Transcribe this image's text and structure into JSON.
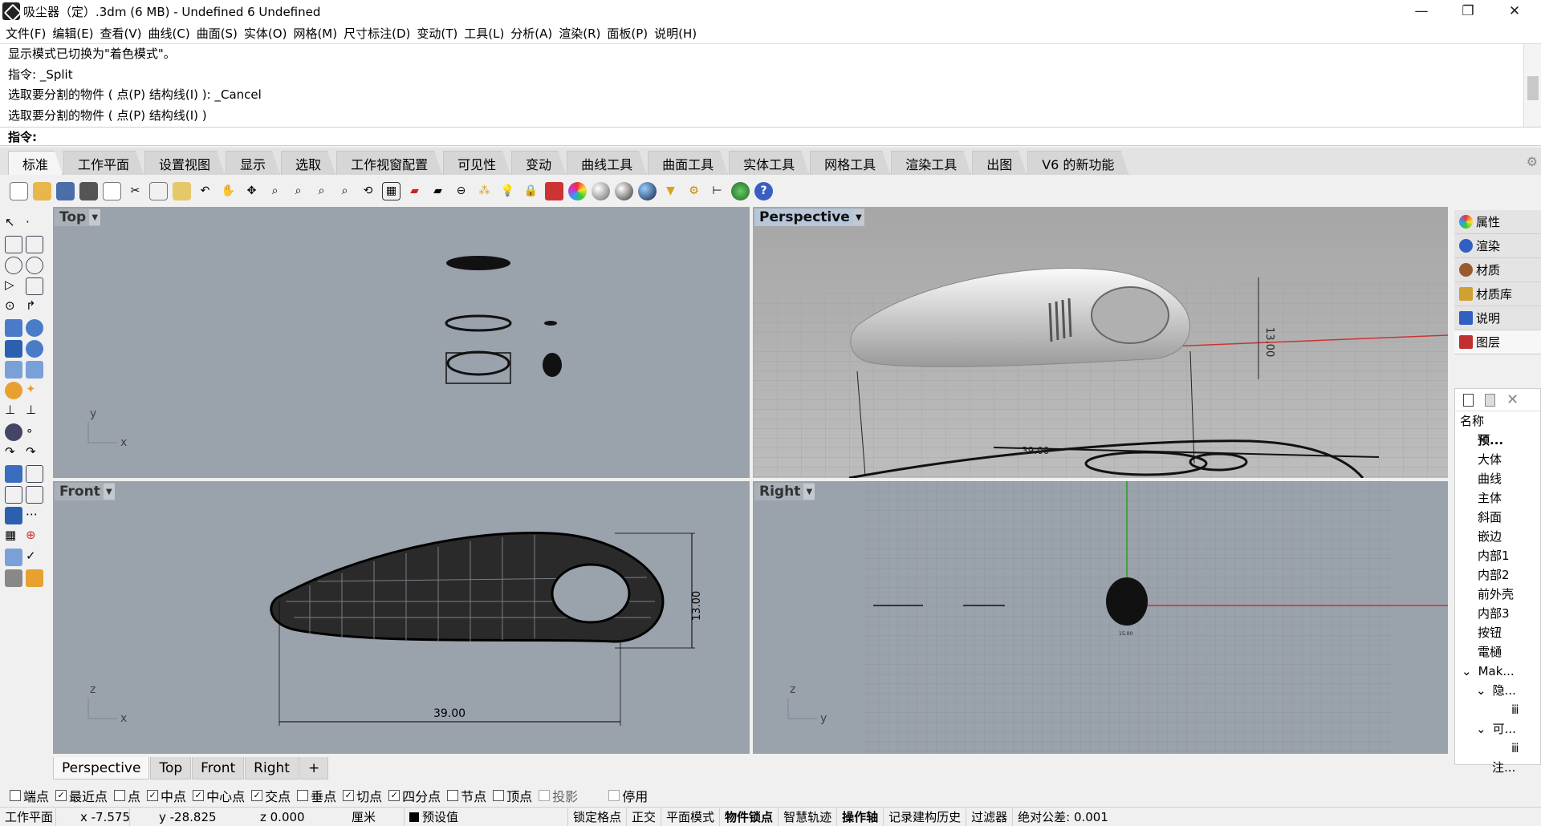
{
  "window": {
    "title": "吸尘器（定）.3dm (6 MB) - Undefined 6 Undefined",
    "minimize": "—",
    "maximize": "❐",
    "close": "✕"
  },
  "menu": [
    "文件(F)",
    "编辑(E)",
    "查看(V)",
    "曲线(C)",
    "曲面(S)",
    "实体(O)",
    "网格(M)",
    "尺寸标注(D)",
    "变动(T)",
    "工具(L)",
    "分析(A)",
    "渲染(R)",
    "面板(P)",
    "说明(H)"
  ],
  "command_history": [
    "显示模式已切换为\"着色模式\"。",
    "指令: _Split",
    "选取要分割的物件 ( 点(P)  结构线(I) ): _Cancel",
    "选取要分割的物件 ( 点(P)  结构线(I) )"
  ],
  "command_prompt": {
    "label": "指令:",
    "value": ""
  },
  "toolbar_tabs": [
    "标准",
    "工作平面",
    "设置视图",
    "显示",
    "选取",
    "工作视窗配置",
    "可见性",
    "变动",
    "曲线工具",
    "曲面工具",
    "实体工具",
    "网格工具",
    "渲染工具",
    "出图",
    "V6 的新功能"
  ],
  "active_tab": "标准",
  "viewports": {
    "top": {
      "label": "Top",
      "axis_x": "x",
      "axis_y": "y"
    },
    "perspective": {
      "label": "Perspective",
      "dim_height": "13.00",
      "dim_base": "39.00"
    },
    "front": {
      "label": "Front",
      "axis_x": "x",
      "axis_y": "z",
      "dim_height": "13.00",
      "dim_length": "39.00"
    },
    "right": {
      "label": "Right",
      "axis_x": "y",
      "axis_y": "z",
      "dim_small": "15.00"
    }
  },
  "viewport_tabs": [
    "Perspective",
    "Top",
    "Front",
    "Right"
  ],
  "viewport_tab_add": "+",
  "right_panel": {
    "tabs": [
      {
        "label": "属性",
        "color": "#d04040"
      },
      {
        "label": "渲染",
        "color": "#3060c0"
      },
      {
        "label": "材质",
        "color": "#9a5a30"
      },
      {
        "label": "材质库",
        "color": "#d0a030"
      },
      {
        "label": "说明",
        "color": "#3060c0"
      },
      {
        "label": "图层",
        "color": "#c03030"
      }
    ],
    "layers_header": "名称",
    "layers": [
      "预...",
      "大体",
      "曲线",
      "主体",
      "斜面",
      "嵌边",
      "内部1",
      "内部2",
      "前外壳",
      "内部3",
      "按钮",
      "電樋",
      "Mak...",
      "隐...",
      "ⅲ",
      "可...",
      "ⅲ",
      "注..."
    ]
  },
  "osnaps": [
    {
      "label": "端点",
      "checked": false
    },
    {
      "label": "最近点",
      "checked": true
    },
    {
      "label": "点",
      "checked": false
    },
    {
      "label": "中点",
      "checked": true
    },
    {
      "label": "中心点",
      "checked": true
    },
    {
      "label": "交点",
      "checked": true
    },
    {
      "label": "垂点",
      "checked": false
    },
    {
      "label": "切点",
      "checked": true
    },
    {
      "label": "四分点",
      "checked": true
    },
    {
      "label": "节点",
      "checked": false
    },
    {
      "label": "顶点",
      "checked": false
    },
    {
      "label": "投影",
      "checked": false
    },
    {
      "label": "停用",
      "checked": false
    }
  ],
  "status": {
    "plane": "工作平面",
    "x": "x -7.575",
    "y": "y -28.825",
    "z": "z 0.000",
    "units": "厘米",
    "layer": "预设值",
    "grid_snap": "锁定格点",
    "ortho": "正交",
    "planar": "平面模式",
    "osnap": "物件锁点",
    "smarttrack": "智慧轨迹",
    "gumball": "操作轴",
    "history": "记录建构历史",
    "filter": "过滤器",
    "tolerance": "绝对公差: 0.001"
  }
}
